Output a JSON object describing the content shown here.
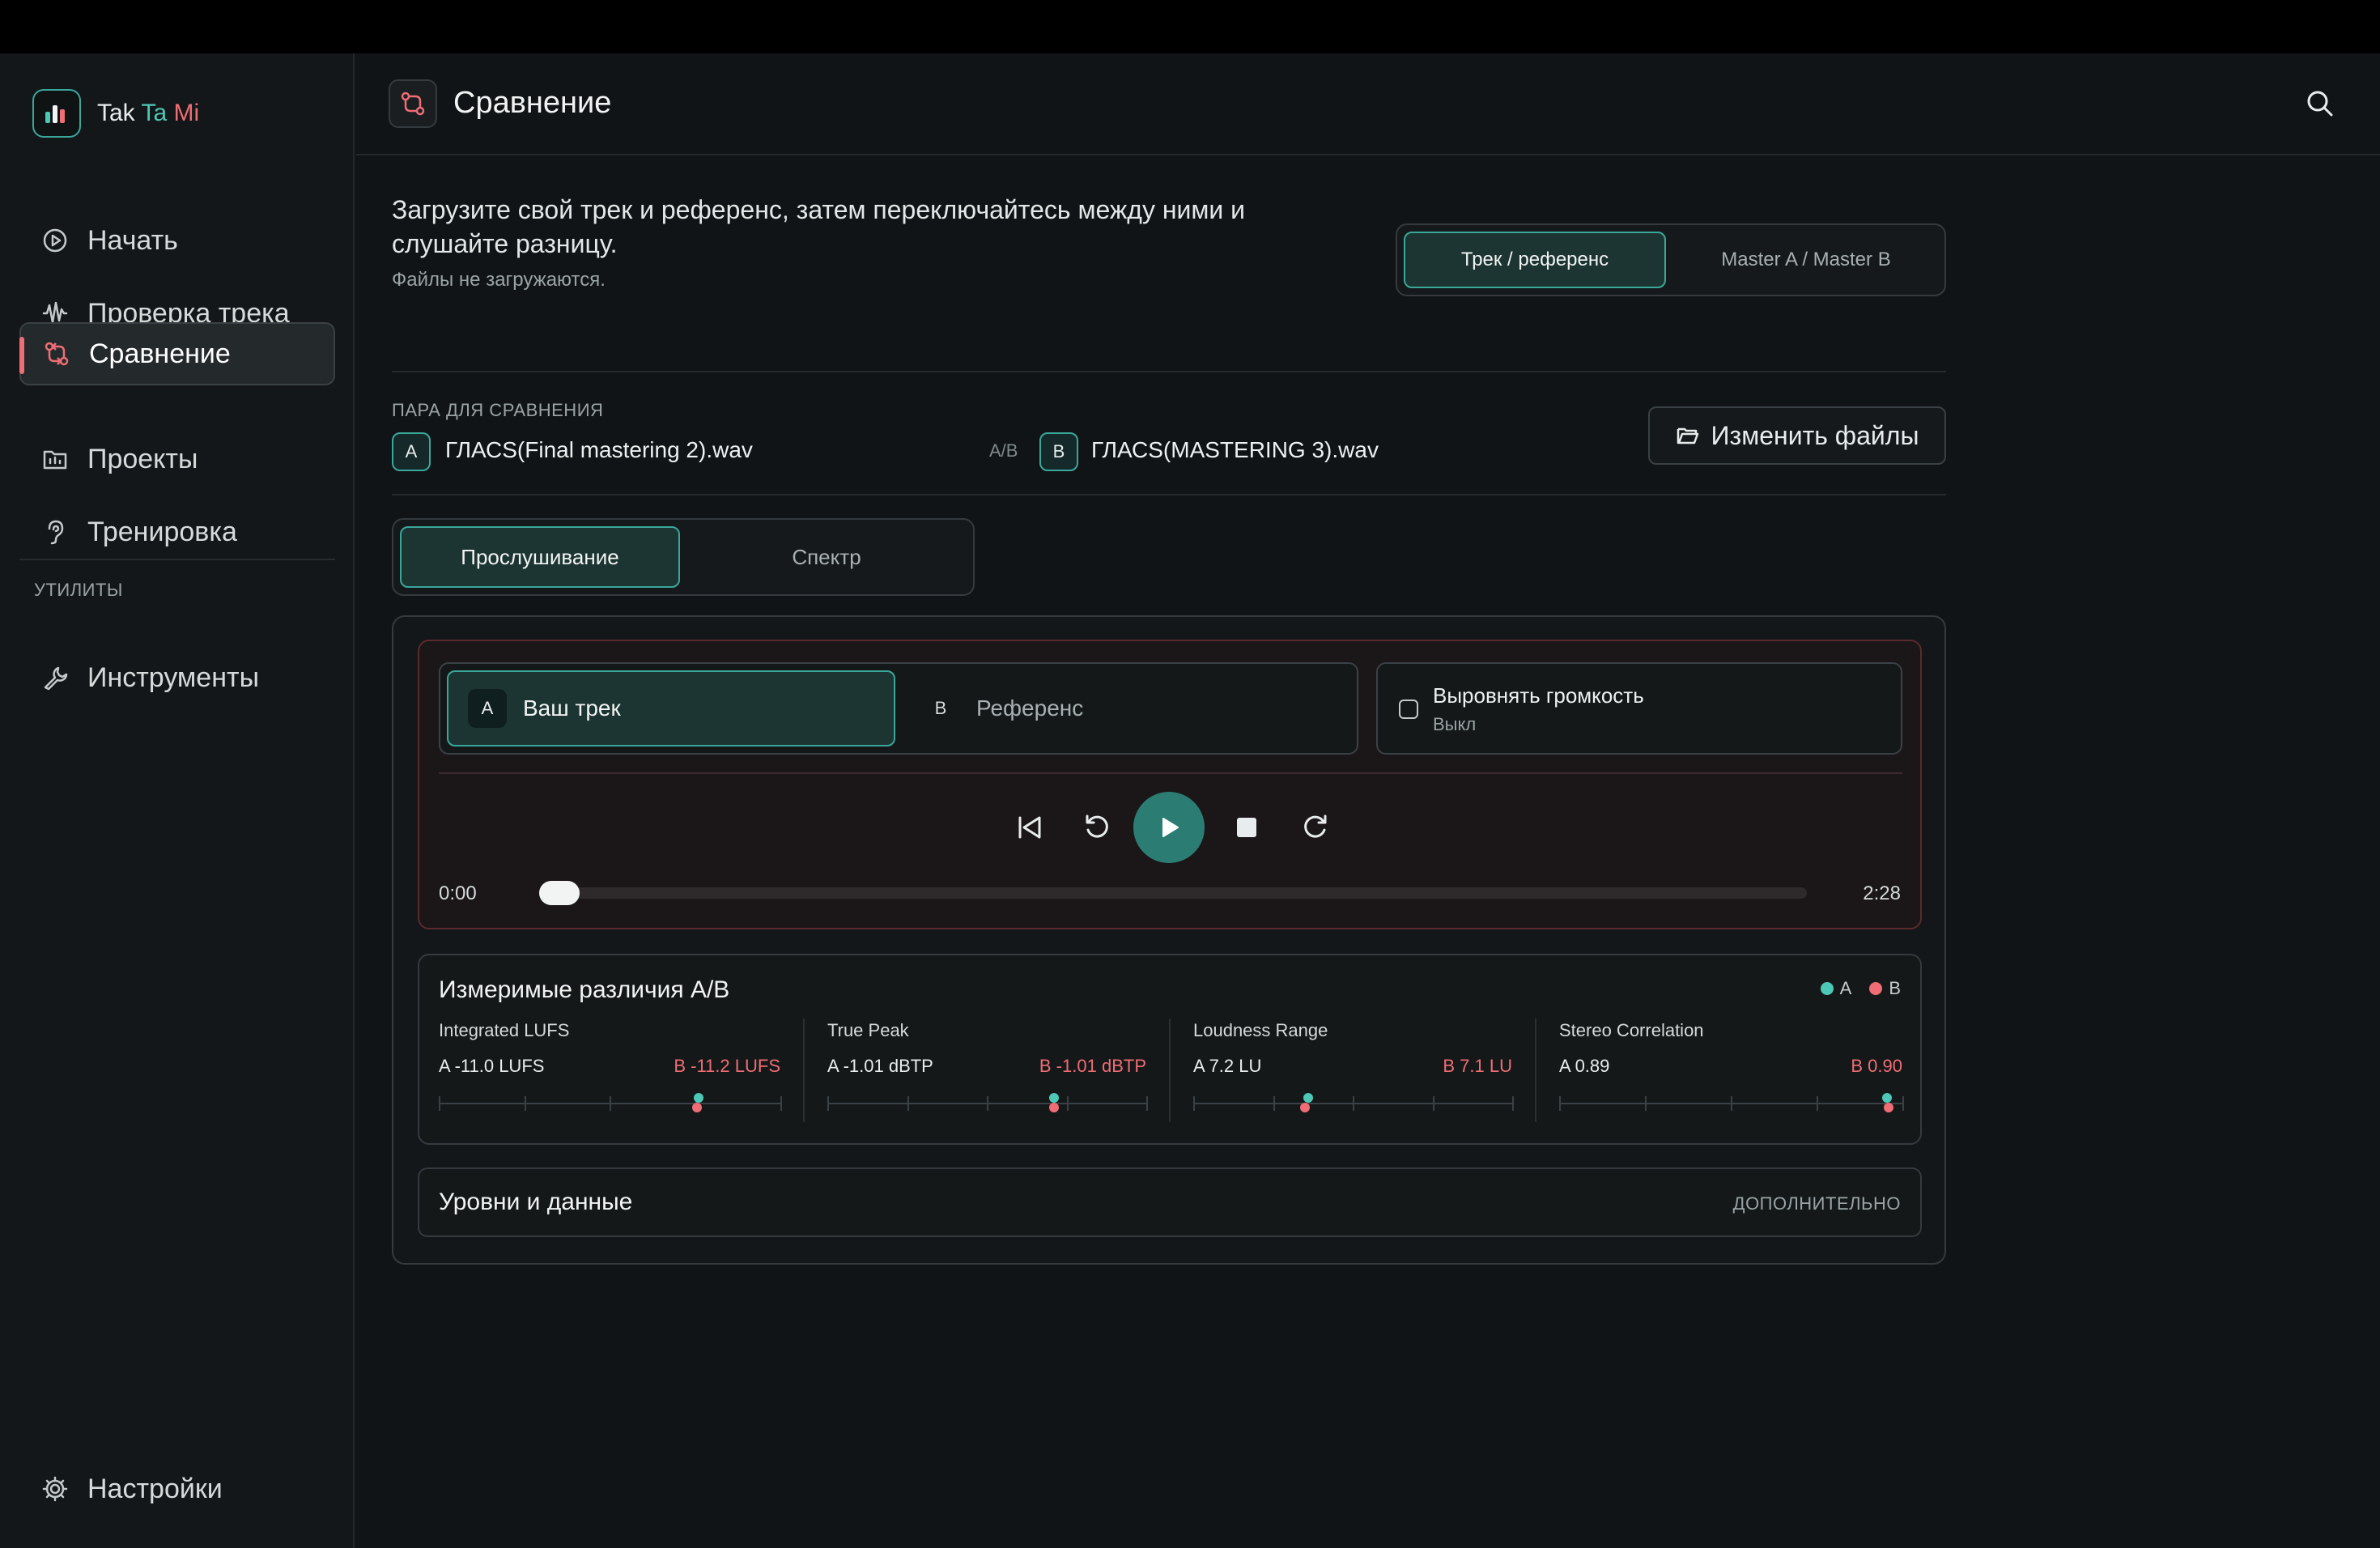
{
  "app": {
    "name_part1": "Tak",
    "name_part2": "Ta",
    "name_part3": "Mi"
  },
  "sidebar": {
    "items": [
      {
        "label": "Начать",
        "icon": "play-circle-icon"
      },
      {
        "label": "Проверка трека",
        "icon": "waveform-icon"
      },
      {
        "label": "Сравнение",
        "icon": "compare-icon",
        "active": true
      },
      {
        "label": "Проекты",
        "icon": "folder-icon"
      },
      {
        "label": "Тренировка",
        "icon": "ear-icon"
      }
    ],
    "section_utils": "УТИЛИТЫ",
    "tools_label": "Инструменты",
    "settings_label": "Настройки"
  },
  "header": {
    "title": "Сравнение"
  },
  "intro": {
    "text": "Загрузите свой трек и референс, затем переключайтесь между ними и слушайте разницу.",
    "note": "Файлы не загружаются."
  },
  "mode_switch": {
    "options": [
      "Трек / референс",
      "Master A / Master B"
    ],
    "selected": "Трек / референс"
  },
  "pair": {
    "label": "ПАРА ДЛЯ СРАВНЕНИЯ",
    "a_letter": "A",
    "a_file": "ГЛАСS(Final mastering 2).wav",
    "separator": "A/B",
    "b_letter": "B",
    "b_file": "ГЛАСS(MASTERING 3).wav",
    "change_label": "Изменить файлы"
  },
  "view_tabs": {
    "options": [
      "Прослушивание",
      "Спектр"
    ],
    "selected": "Прослушивание"
  },
  "player": {
    "a_letter": "A",
    "a_label": "Ваш трек",
    "b_letter": "B",
    "b_label": "Референс",
    "loudness_title": "Выровнять громкость",
    "loudness_state": "Выкл",
    "time_current": "0:00",
    "time_total": "2:28",
    "progress": 0
  },
  "metrics": {
    "title": "Измеримые различия A/B",
    "legend_a": "A",
    "legend_b": "B",
    "color_a": "#4ec8b6",
    "color_b": "#ef6d74",
    "items": [
      {
        "name": "Integrated LUFS",
        "a": "A -11.0 LUFS",
        "b": "B -11.2 LUFS",
        "a_pos": 0.76,
        "b_pos": 0.755
      },
      {
        "name": "True Peak",
        "a": "A -1.01 dBTP",
        "b": "B -1.01 dBTP",
        "a_pos": 0.71,
        "b_pos": 0.71
      },
      {
        "name": "Loudness Range",
        "a": "A 7.2 LU",
        "b": "B 7.1 LU",
        "a_pos": 0.36,
        "b_pos": 0.35
      },
      {
        "name": "Stereo Correlation",
        "a": "A 0.89",
        "b": "B 0.90",
        "a_pos": 0.955,
        "b_pos": 0.96
      }
    ]
  },
  "levels": {
    "title": "Уровни и данные",
    "more": "ДОПОЛНИТЕЛЬНО"
  }
}
